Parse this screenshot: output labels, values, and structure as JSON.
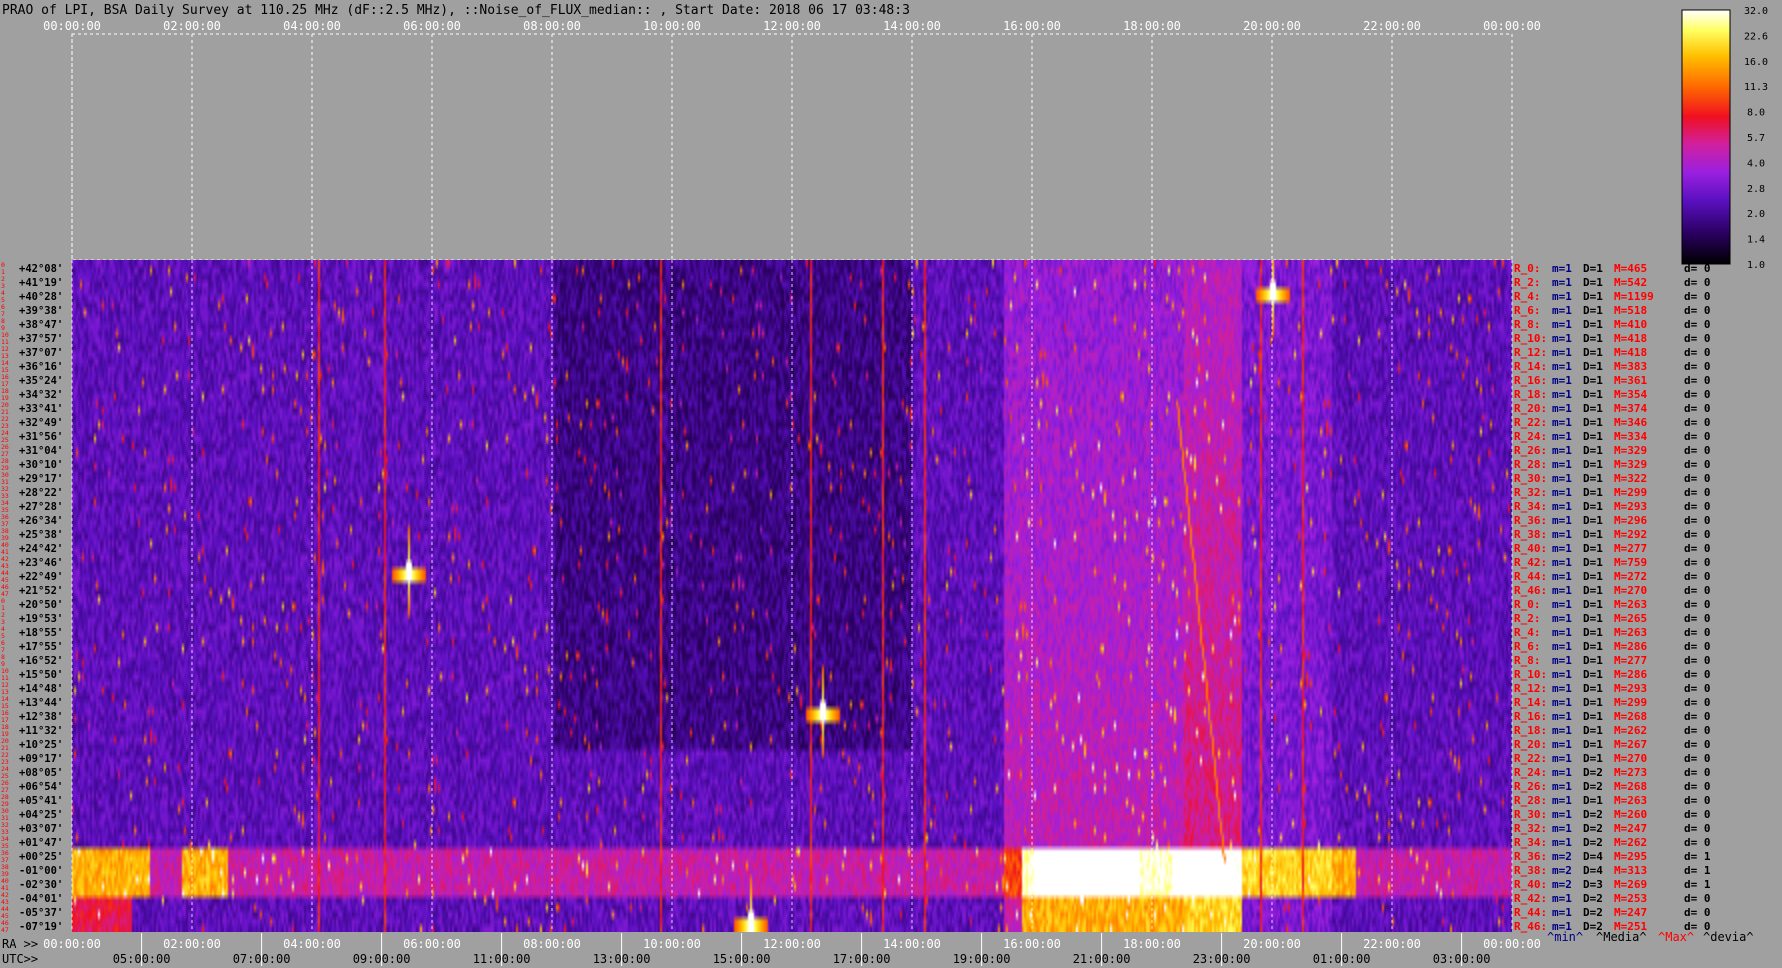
{
  "chart_data": {
    "type": "heatmap",
    "title": "PRAO of LPI, BSA Daily Survey at 110.25 MHz (dF::2.5 MHz), ::Noise_of_FLUX_median:: , Start Date: 2018 06 17 03:48:3",
    "x_top_ticks": [
      "00:00:00",
      "02:00:00",
      "04:00:00",
      "06:00:00",
      "08:00:00",
      "10:00:00",
      "12:00:00",
      "14:00:00",
      "16:00:00",
      "18:00:00",
      "20:00:00",
      "22:00:00",
      "00:00:00"
    ],
    "ra_label": "RA >>",
    "ra_ticks": [
      "00:00:00",
      "02:00:00",
      "04:00:00",
      "06:00:00",
      "08:00:00",
      "10:00:00",
      "12:00:00",
      "14:00:00",
      "16:00:00",
      "18:00:00",
      "20:00:00",
      "22:00:00",
      "00:00:00"
    ],
    "utc_label": "UTC>>",
    "utc_ticks": [
      "05:00:00",
      "07:00:00",
      "09:00:00",
      "11:00:00",
      "13:00:00",
      "15:00:00",
      "17:00:00",
      "19:00:00",
      "21:00:00",
      "23:00:00",
      "01:00:00",
      "03:00:00"
    ],
    "dec_ticks": [
      "+42°08'",
      "+41°19'",
      "+40°28'",
      "+39°38'",
      "+38°47'",
      "+37°57'",
      "+37°07'",
      "+36°16'",
      "+35°24'",
      "+34°32'",
      "+33°41'",
      "+32°49'",
      "+31°56'",
      "+31°04'",
      "+30°10'",
      "+29°17'",
      "+28°22'",
      "+27°28'",
      "+26°34'",
      "+25°38'",
      "+24°42'",
      "+23°46'",
      "+22°49'",
      "+21°52'",
      "+20°50'",
      "+19°53'",
      "+18°55'",
      "+17°55'",
      "+16°52'",
      "+15°50'",
      "+14°48'",
      "+13°44'",
      "+12°38'",
      "+11°32'",
      "+10°25'",
      "+09°17'",
      "+08°05'",
      "+06°54'",
      "+05°41'",
      "+04°25'",
      "+03°07'",
      "+01°47'",
      "+00°25'",
      "-01°00'",
      "-02°30'",
      "-04°01'",
      "-05°37'",
      "-07°19'"
    ],
    "row_index_labels": [
      "0",
      "1",
      "2",
      "3",
      "4",
      "5",
      "6",
      "7",
      "8",
      "9",
      "10",
      "11",
      "12",
      "13",
      "14",
      "15",
      "16",
      "17",
      "18",
      "19",
      "20",
      "21",
      "22",
      "23",
      "24",
      "25",
      "26",
      "27",
      "28",
      "29",
      "30",
      "31",
      "32",
      "33",
      "34",
      "35",
      "36",
      "37",
      "38",
      "39",
      "40",
      "41",
      "42",
      "43",
      "44",
      "45",
      "46",
      "47",
      "0",
      "1",
      "2",
      "3",
      "4",
      "5",
      "6",
      "7",
      "8",
      "9",
      "10",
      "11",
      "12",
      "13",
      "14",
      "15",
      "16",
      "17",
      "18",
      "19",
      "20",
      "21",
      "22",
      "23",
      "24",
      "25",
      "26",
      "27",
      "28",
      "29",
      "30",
      "31",
      "32",
      "33",
      "34",
      "35",
      "36",
      "37",
      "38",
      "39",
      "40",
      "41",
      "42",
      "43",
      "44",
      "45",
      "46",
      "47"
    ],
    "colorbar": {
      "ticks": [
        "32.0",
        "22.6",
        "16.0",
        "11.3",
        "8.0",
        "5.7",
        "4.0",
        "2.8",
        "2.0",
        "1.4",
        "1.0"
      ],
      "scale": "log"
    },
    "row_stats": [
      {
        "r": "R_0:",
        "m": "m=1",
        "D": "D=1",
        "M": "M=465",
        "d": "d= 0"
      },
      {
        "r": "R_2:",
        "m": "m=1",
        "D": "D=1",
        "M": "M=542",
        "d": "d= 0"
      },
      {
        "r": "R_4:",
        "m": "m=1",
        "D": "D=1",
        "M": "M=1199",
        "d": "d= 0"
      },
      {
        "r": "R_6:",
        "m": "m=1",
        "D": "D=1",
        "M": "M=518",
        "d": "d= 0"
      },
      {
        "r": "R_8:",
        "m": "m=1",
        "D": "D=1",
        "M": "M=410",
        "d": "d= 0"
      },
      {
        "r": "R_10:",
        "m": "m=1",
        "D": "D=1",
        "M": "M=418",
        "d": "d= 0"
      },
      {
        "r": "R_12:",
        "m": "m=1",
        "D": "D=1",
        "M": "M=418",
        "d": "d= 0"
      },
      {
        "r": "R_14:",
        "m": "m=1",
        "D": "D=1",
        "M": "M=383",
        "d": "d= 0"
      },
      {
        "r": "R_16:",
        "m": "m=1",
        "D": "D=1",
        "M": "M=361",
        "d": "d= 0"
      },
      {
        "r": "R_18:",
        "m": "m=1",
        "D": "D=1",
        "M": "M=354",
        "d": "d= 0"
      },
      {
        "r": "R_20:",
        "m": "m=1",
        "D": "D=1",
        "M": "M=374",
        "d": "d= 0"
      },
      {
        "r": "R_22:",
        "m": "m=1",
        "D": "D=1",
        "M": "M=346",
        "d": "d= 0"
      },
      {
        "r": "R_24:",
        "m": "m=1",
        "D": "D=1",
        "M": "M=334",
        "d": "d= 0"
      },
      {
        "r": "R_26:",
        "m": "m=1",
        "D": "D=1",
        "M": "M=329",
        "d": "d= 0"
      },
      {
        "r": "R_28:",
        "m": "m=1",
        "D": "D=1",
        "M": "M=329",
        "d": "d= 0"
      },
      {
        "r": "R_30:",
        "m": "m=1",
        "D": "D=1",
        "M": "M=322",
        "d": "d= 0"
      },
      {
        "r": "R_32:",
        "m": "m=1",
        "D": "D=1",
        "M": "M=299",
        "d": "d= 0"
      },
      {
        "r": "R_34:",
        "m": "m=1",
        "D": "D=1",
        "M": "M=293",
        "d": "d= 0"
      },
      {
        "r": "R_36:",
        "m": "m=1",
        "D": "D=1",
        "M": "M=296",
        "d": "d= 0"
      },
      {
        "r": "R_38:",
        "m": "m=1",
        "D": "D=1",
        "M": "M=292",
        "d": "d= 0"
      },
      {
        "r": "R_40:",
        "m": "m=1",
        "D": "D=1",
        "M": "M=277",
        "d": "d= 0"
      },
      {
        "r": "R_42:",
        "m": "m=1",
        "D": "D=1",
        "M": "M=759",
        "d": "d= 0"
      },
      {
        "r": "R_44:",
        "m": "m=1",
        "D": "D=1",
        "M": "M=272",
        "d": "d= 0"
      },
      {
        "r": "R_46:",
        "m": "m=1",
        "D": "D=1",
        "M": "M=270",
        "d": "d= 0"
      },
      {
        "r": "R_0:",
        "m": "m=1",
        "D": "D=1",
        "M": "M=263",
        "d": "d= 0"
      },
      {
        "r": "R_2:",
        "m": "m=1",
        "D": "D=1",
        "M": "M=265",
        "d": "d= 0"
      },
      {
        "r": "R_4:",
        "m": "m=1",
        "D": "D=1",
        "M": "M=263",
        "d": "d= 0"
      },
      {
        "r": "R_6:",
        "m": "m=1",
        "D": "D=1",
        "M": "M=286",
        "d": "d= 0"
      },
      {
        "r": "R_8:",
        "m": "m=1",
        "D": "D=1",
        "M": "M=277",
        "d": "d= 0"
      },
      {
        "r": "R_10:",
        "m": "m=1",
        "D": "D=1",
        "M": "M=286",
        "d": "d= 0"
      },
      {
        "r": "R_12:",
        "m": "m=1",
        "D": "D=1",
        "M": "M=293",
        "d": "d= 0"
      },
      {
        "r": "R_14:",
        "m": "m=1",
        "D": "D=1",
        "M": "M=299",
        "d": "d= 0"
      },
      {
        "r": "R_16:",
        "m": "m=1",
        "D": "D=1",
        "M": "M=268",
        "d": "d= 0"
      },
      {
        "r": "R_18:",
        "m": "m=1",
        "D": "D=1",
        "M": "M=262",
        "d": "d= 0"
      },
      {
        "r": "R_20:",
        "m": "m=1",
        "D": "D=1",
        "M": "M=267",
        "d": "d= 0"
      },
      {
        "r": "R_22:",
        "m": "m=1",
        "D": "D=1",
        "M": "M=270",
        "d": "d= 0"
      },
      {
        "r": "R_24:",
        "m": "m=1",
        "D": "D=2",
        "M": "M=273",
        "d": "d= 0"
      },
      {
        "r": "R_26:",
        "m": "m=1",
        "D": "D=2",
        "M": "M=268",
        "d": "d= 0"
      },
      {
        "r": "R_28:",
        "m": "m=1",
        "D": "D=1",
        "M": "M=263",
        "d": "d= 0"
      },
      {
        "r": "R_30:",
        "m": "m=1",
        "D": "D=2",
        "M": "M=260",
        "d": "d= 0"
      },
      {
        "r": "R_32:",
        "m": "m=1",
        "D": "D=2",
        "M": "M=247",
        "d": "d= 0"
      },
      {
        "r": "R_34:",
        "m": "m=1",
        "D": "D=2",
        "M": "M=262",
        "d": "d= 0"
      },
      {
        "r": "R_36:",
        "m": "m=2",
        "D": "D=4",
        "M": "M=295",
        "d": "d= 1"
      },
      {
        "r": "R_38:",
        "m": "m=2",
        "D": "D=4",
        "M": "M=313",
        "d": "d= 1"
      },
      {
        "r": "R_40:",
        "m": "m=2",
        "D": "D=3",
        "M": "M=269",
        "d": "d= 1"
      },
      {
        "r": "R_42:",
        "m": "m=1",
        "D": "D=2",
        "M": "M=253",
        "d": "d= 0"
      },
      {
        "r": "R_44:",
        "m": "m=1",
        "D": "D=2",
        "M": "M=247",
        "d": "d= 0"
      },
      {
        "r": "R_46:",
        "m": "m=1",
        "D": "D=2",
        "M": "M=251",
        "d": "d= 0"
      }
    ],
    "legend_footer": {
      "min": "^min^",
      "media": "^Media^",
      "max": "^Max^",
      "devia": "^devia^"
    },
    "sources": [
      {
        "ra_h": 5.6,
        "row": 22
      },
      {
        "ra_h": 20.0,
        "row": 2
      },
      {
        "ra_h": 12.5,
        "row": 32
      },
      {
        "ra_h": 11.3,
        "row": 47
      }
    ],
    "colors": {
      "background": "#a0a0a0",
      "bright": "#ffffff",
      "label_red": "#ff0000",
      "label_blue": "#000080",
      "tick_text": "#ffffff"
    }
  }
}
